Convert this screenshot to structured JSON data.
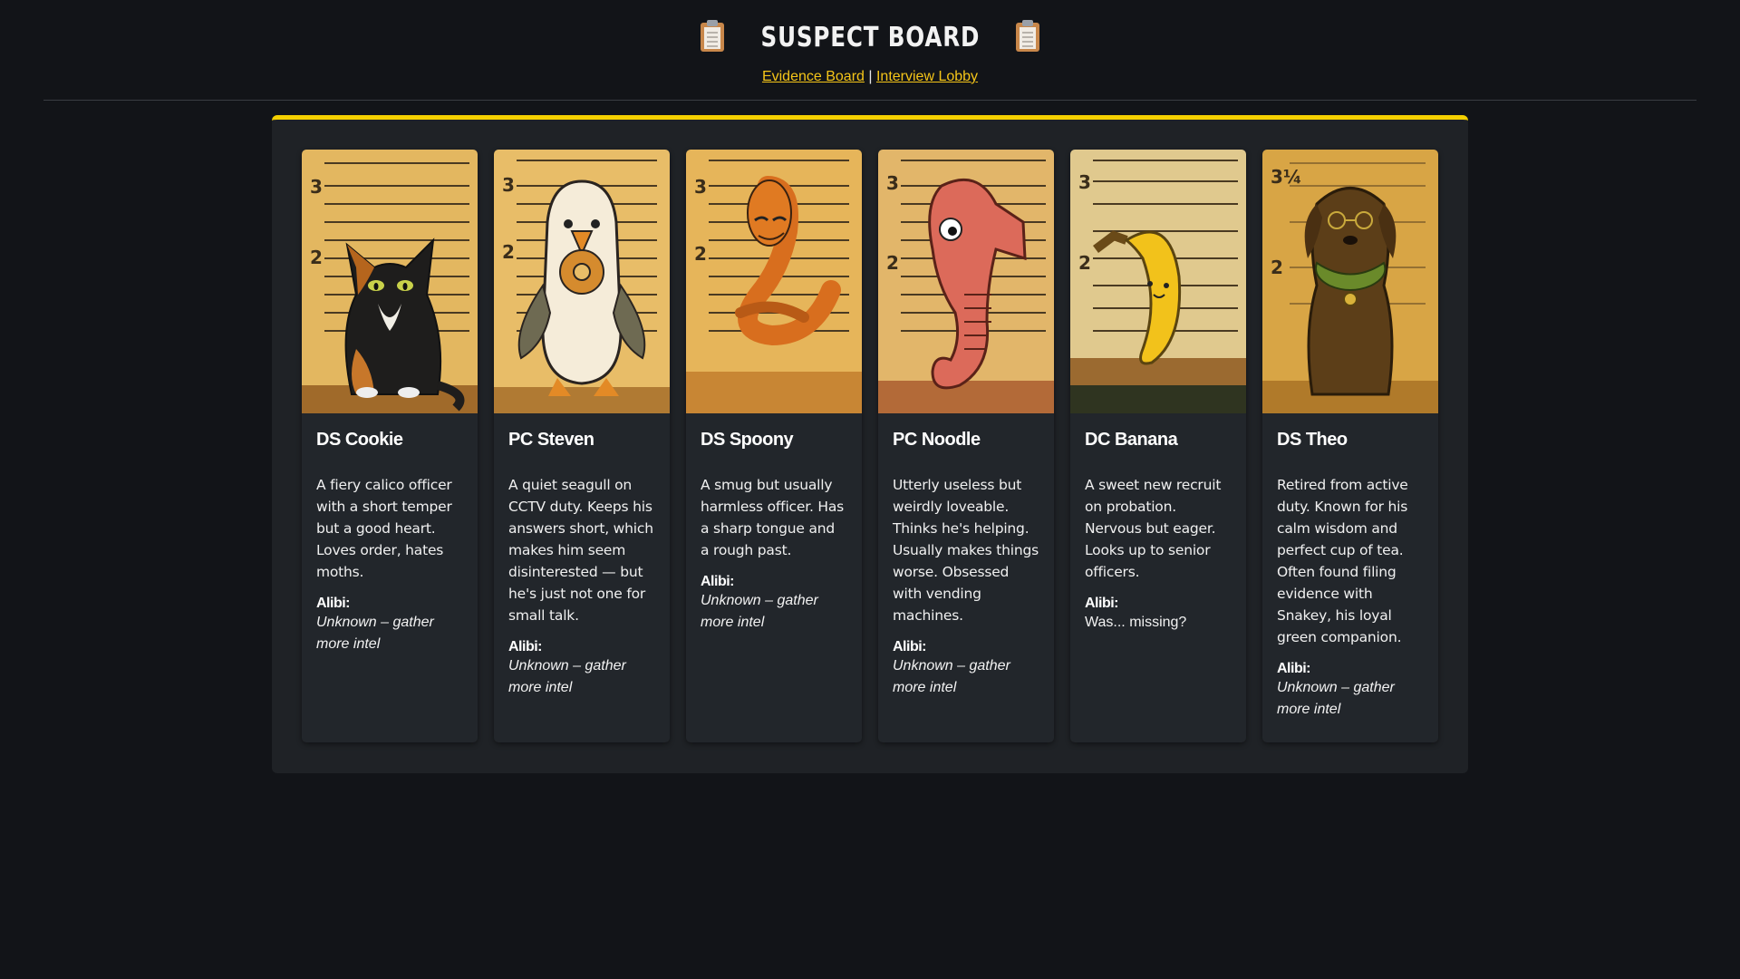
{
  "header": {
    "title": "Suspect Board",
    "nav": [
      {
        "label": "Evidence Board"
      },
      {
        "label": "Interview Lobby"
      }
    ],
    "separator": "|"
  },
  "colors": {
    "background": "#121418",
    "accent": "#f5d000",
    "link": "#f5c518",
    "card": "#22262b"
  },
  "suspects": [
    {
      "name": "DS Cookie",
      "description": "A fiery calico officer with a short temper but a good heart. Loves order, hates moths.",
      "alibi_label": "Alibi:",
      "alibi": "Unknown – gather more intel",
      "photo": "calico-cat-mugshot",
      "height_marks": [
        "3",
        "2"
      ]
    },
    {
      "name": "PC Steven",
      "description": "A quiet seagull on CCTV duty. Keeps his answers short, which makes him seem disinterested — but he's just not one for small talk.",
      "alibi_label": "Alibi:",
      "alibi": "Unknown – gather more intel",
      "photo": "seagull-with-donut-mugshot",
      "height_marks": [
        "3",
        "2"
      ]
    },
    {
      "name": "DS Spoony",
      "description": "A smug but usually harmless officer. Has a sharp tongue and a rough past.",
      "alibi_label": "Alibi:",
      "alibi": "Unknown – gather more intel",
      "photo": "snake-mugshot",
      "height_marks": [
        "3",
        "2"
      ]
    },
    {
      "name": "PC Noodle",
      "description": "Utterly useless but weirdly loveable. Thinks he's helping. Usually makes things worse. Obsessed with vending machines.",
      "alibi_label": "Alibi:",
      "alibi": "Unknown – gather more intel",
      "photo": "seahorse-mugshot",
      "height_marks": [
        "3",
        "2"
      ]
    },
    {
      "name": "DC Banana",
      "description": "A sweet new recruit on probation. Nervous but eager. Looks up to senior officers.",
      "alibi_label": "Alibi:",
      "alibi": "Was... missing?",
      "photo": "banana-mugshot",
      "height_marks": [
        "3",
        "2"
      ]
    },
    {
      "name": "DS Theo",
      "description": "Retired from active duty. Known for his calm wisdom and perfect cup of tea. Often found filing evidence with Snakey, his loyal green companion.",
      "alibi_label": "Alibi:",
      "alibi": "Unknown – gather more intel",
      "photo": "dog-with-snake-mugshot",
      "height_marks": [
        "3¼",
        "2"
      ]
    }
  ]
}
